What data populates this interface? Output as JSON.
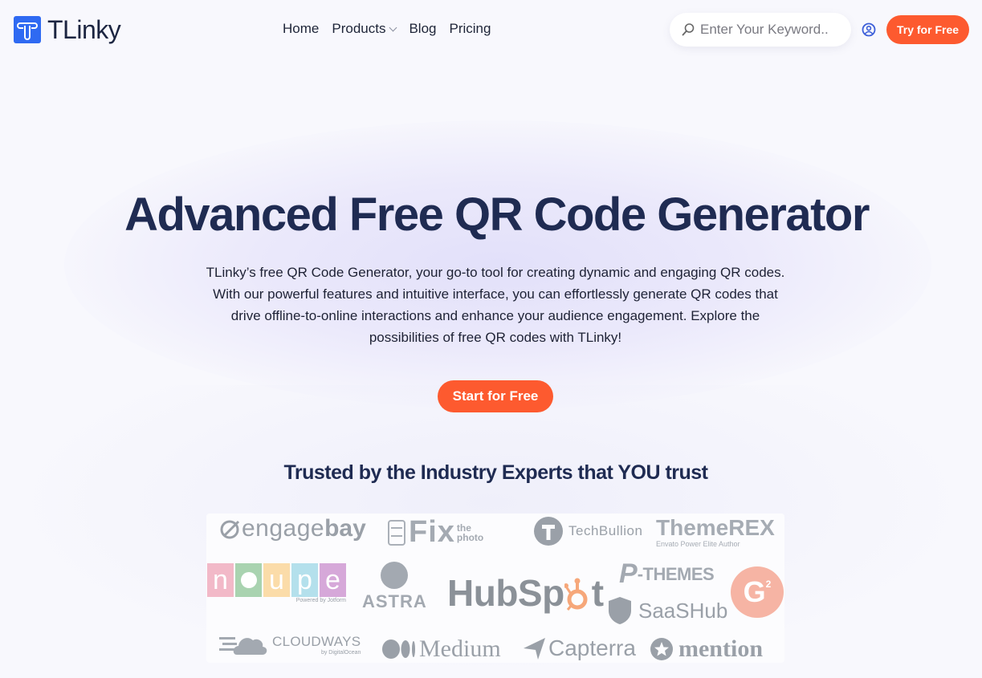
{
  "brand": {
    "name": "TLinky",
    "accent": "#2f6af2",
    "cta_color": "#fd5a2f"
  },
  "nav": {
    "items": [
      {
        "label": "Home"
      },
      {
        "label": "Products",
        "has_dropdown": true
      },
      {
        "label": "Blog"
      },
      {
        "label": "Pricing"
      }
    ]
  },
  "search": {
    "placeholder": "Enter Your Keyword..",
    "value": "",
    "icon": "search-icon"
  },
  "header": {
    "user_icon": "user-circle-icon",
    "cta_label": "Try for Free"
  },
  "hero": {
    "title": "Advanced Free QR Code Generator",
    "description": "TLinky’s free QR Code Generator, your go-to tool for creating dynamic and engaging QR codes. With our powerful features and intuitive interface, you can effortlessly generate QR codes that drive offline-to-online interactions and enhance your audience engagement. Explore the possibilities of free QR codes with TLinky!",
    "cta_label": "Start for Free"
  },
  "trusted": {
    "heading": "Trusted by the Industry Experts that YOU trust",
    "logos": {
      "engagebay": {
        "light": "engage",
        "bold": "bay"
      },
      "fixthephoto": {
        "main": "Fix",
        "sub1": "the",
        "sub2": "photo"
      },
      "techbullion": {
        "text": "TechBullion"
      },
      "themerex": {
        "text": "ThemeREX",
        "sub": "Envato Power Elite Author"
      },
      "noupe": {
        "letters": [
          "n",
          "o",
          "u",
          "p",
          "e"
        ],
        "sub": "Powered by Jotform"
      },
      "astra": {
        "text": "ASTRA"
      },
      "hubspot": {
        "text1": "HubSp",
        "text2": "t"
      },
      "pthemes": {
        "text": "-THEMES"
      },
      "saashub": {
        "text": "SaaSHub"
      },
      "g2": {
        "text": "G"
      },
      "cloudways": {
        "text": "CLOUDWAYS",
        "sub": "by DigitalOcean"
      },
      "medium": {
        "text": "Medium"
      },
      "capterra": {
        "text": "Capterra"
      },
      "mention": {
        "text": "mention"
      }
    }
  }
}
